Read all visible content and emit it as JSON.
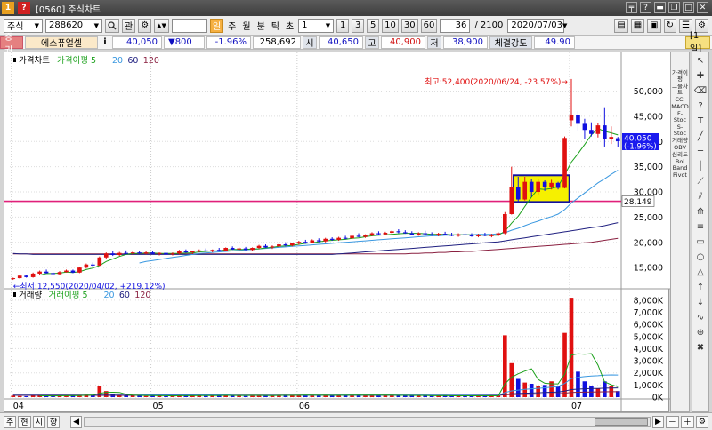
{
  "window": {
    "title": "[0560] 주식차트",
    "app_icon": "1 ?",
    "buttons": [
      "pin-icon",
      "help-icon",
      "minimize-icon",
      "restore-icon",
      "maximize-icon",
      "close-icon"
    ]
  },
  "toolbar": {
    "market": "주식",
    "code": "288620",
    "search_glyph": "🔍",
    "관": "관",
    "period_tabs": [
      "일",
      "주",
      "월",
      "분",
      "틱",
      "초"
    ],
    "interval_value": "1",
    "interval_btns": [
      "1",
      "3",
      "5",
      "10",
      "30",
      "60"
    ],
    "count_value": "36",
    "total_value": "/ 2100",
    "date_value": "2020/07/03"
  },
  "infobar": {
    "badge": "증권",
    "name": "에스퓨얼셀",
    "info_icon": "i",
    "price": "40,050",
    "change": "▼800",
    "rate": "-1.96%",
    "volume": "258,692",
    "open_lbl": "시",
    "open": "40,650",
    "high_lbl": "고",
    "high": "40,900",
    "low_lbl": "저",
    "low": "38,900",
    "strength_lbl": "체결강도",
    "strength": "49.90",
    "period_badge": "[1일]"
  },
  "price_chart": {
    "legend": [
      "가격차트",
      "가격이평 5",
      "20",
      "60",
      "120"
    ],
    "max_label": "최고:52,400(2020/06/24, -23.57%)→",
    "min_label": "←최저:12,550(2020/04/02, +219.12%)",
    "current_price": "40,050",
    "current_rate": "(-1.96%)",
    "line_value": "28,149",
    "y_ticks": [
      "50,000",
      "45,000",
      "40,000",
      "35,000",
      "30,000",
      "25,000",
      "20,000",
      "15,000"
    ]
  },
  "volume_chart": {
    "legend": [
      "거래량",
      "거래이평 5",
      "20",
      "60",
      "120"
    ],
    "y_ticks": [
      "8,000K",
      "7,000K",
      "6,000K",
      "5,000K",
      "4,000K",
      "3,000K",
      "2,000K",
      "1,000K",
      "0K"
    ]
  },
  "x_ticks": [
    "04",
    "05",
    "06",
    "07"
  ],
  "right_panel": [
    "가격이평",
    "그물차트",
    "CCI",
    "MACD",
    "F-Stoc",
    "S-Stoc",
    "거래량",
    "OBV",
    "심리도",
    "Bol Band",
    "Pivot"
  ],
  "bottom": {
    "tabs": [
      "주",
      "현",
      "시",
      "향"
    ]
  },
  "colors": {
    "up": "#e01010",
    "down": "#1010e0",
    "ma5": "#1aa01a",
    "ma20": "#3a98e0",
    "ma60": "#202080",
    "ma120": "#8a2040",
    "hline": "#e0207a",
    "highlight": "#f6f000"
  },
  "chart_data": {
    "type": "candlestick",
    "price_ylim": [
      11500,
      54500
    ],
    "volume_ylim": [
      0,
      8500
    ],
    "candles": [
      [
        12.8,
        13.0,
        12.55,
        12.9
      ],
      [
        12.9,
        13.6,
        12.8,
        13.4
      ],
      [
        13.4,
        13.6,
        13.0,
        13.1
      ],
      [
        13.1,
        14.0,
        13.0,
        13.8
      ],
      [
        13.8,
        14.4,
        13.6,
        14.2
      ],
      [
        14.2,
        14.6,
        13.8,
        13.9
      ],
      [
        13.9,
        14.2,
        13.5,
        13.7
      ],
      [
        13.7,
        14.3,
        13.6,
        14.1
      ],
      [
        14.1,
        14.6,
        14.0,
        14.4
      ],
      [
        14.4,
        14.6,
        13.9,
        14.0
      ],
      [
        14.0,
        15.2,
        13.9,
        15.0
      ],
      [
        15.0,
        15.8,
        14.8,
        15.6
      ],
      [
        15.6,
        16.0,
        15.2,
        15.4
      ],
      [
        15.4,
        17.2,
        15.3,
        17.0
      ],
      [
        17.0,
        18.0,
        16.7,
        17.8
      ],
      [
        17.8,
        18.3,
        17.3,
        17.5
      ],
      [
        17.5,
        18.1,
        17.3,
        17.9
      ],
      [
        17.9,
        18.4,
        17.6,
        17.8
      ],
      [
        17.8,
        18.2,
        17.5,
        18.0
      ],
      [
        18.0,
        18.3,
        17.7,
        17.8
      ],
      [
        17.8,
        18.2,
        17.6,
        18.0
      ],
      [
        18.0,
        18.2,
        17.6,
        17.7
      ],
      [
        17.7,
        18.0,
        17.4,
        17.9
      ],
      [
        17.9,
        18.1,
        17.5,
        17.6
      ],
      [
        17.6,
        18.0,
        17.4,
        17.8
      ],
      [
        17.8,
        18.5,
        17.6,
        18.3
      ],
      [
        18.3,
        18.6,
        17.9,
        18.0
      ],
      [
        18.0,
        18.3,
        17.7,
        18.2
      ],
      [
        18.2,
        18.6,
        18.0,
        18.4
      ],
      [
        18.4,
        18.8,
        18.1,
        18.2
      ],
      [
        18.2,
        18.6,
        18.0,
        18.5
      ],
      [
        18.5,
        18.9,
        18.2,
        18.3
      ],
      [
        18.3,
        19.0,
        18.2,
        18.9
      ],
      [
        18.9,
        19.2,
        18.5,
        18.6
      ],
      [
        18.6,
        19.0,
        18.4,
        18.8
      ],
      [
        18.8,
        19.1,
        18.4,
        18.5
      ],
      [
        18.5,
        19.0,
        18.3,
        18.9
      ],
      [
        18.9,
        19.5,
        18.7,
        19.3
      ],
      [
        19.3,
        19.6,
        18.9,
        19.0
      ],
      [
        19.0,
        19.4,
        18.7,
        19.2
      ],
      [
        19.2,
        19.8,
        19.0,
        19.6
      ],
      [
        19.6,
        20.0,
        19.2,
        19.4
      ],
      [
        19.4,
        19.9,
        19.2,
        19.8
      ],
      [
        19.8,
        20.3,
        19.5,
        20.1
      ],
      [
        20.1,
        20.5,
        19.7,
        19.9
      ],
      [
        19.9,
        20.6,
        19.8,
        20.4
      ],
      [
        20.4,
        20.8,
        20.0,
        20.2
      ],
      [
        20.2,
        20.9,
        20.0,
        20.7
      ],
      [
        20.7,
        21.0,
        20.3,
        20.5
      ],
      [
        20.5,
        21.1,
        20.3,
        20.9
      ],
      [
        20.9,
        21.3,
        20.6,
        20.8
      ],
      [
        20.8,
        21.5,
        20.6,
        21.3
      ],
      [
        21.3,
        21.8,
        21.0,
        21.1
      ],
      [
        21.1,
        21.6,
        20.9,
        21.4
      ],
      [
        21.4,
        22.0,
        21.2,
        21.8
      ],
      [
        21.8,
        22.2,
        21.4,
        21.6
      ],
      [
        21.6,
        22.1,
        21.4,
        21.9
      ],
      [
        21.9,
        22.4,
        21.6,
        22.2
      ],
      [
        22.2,
        22.6,
        21.8,
        22.0
      ],
      [
        22.0,
        22.4,
        21.7,
        21.8
      ],
      [
        21.8,
        22.2,
        21.4,
        21.5
      ],
      [
        21.5,
        22.0,
        21.3,
        21.8
      ],
      [
        21.8,
        22.3,
        21.5,
        21.6
      ],
      [
        21.6,
        22.0,
        21.3,
        21.4
      ],
      [
        21.4,
        21.9,
        21.2,
        21.7
      ],
      [
        21.7,
        22.1,
        21.4,
        21.5
      ],
      [
        21.5,
        21.9,
        21.2,
        21.3
      ],
      [
        21.3,
        21.8,
        21.1,
        21.6
      ],
      [
        21.6,
        22.0,
        21.3,
        21.4
      ],
      [
        21.4,
        21.8,
        21.1,
        21.2
      ],
      [
        21.2,
        21.7,
        21.0,
        21.5
      ],
      [
        21.5,
        21.9,
        21.2,
        21.3
      ],
      [
        21.3,
        21.7,
        21.0,
        21.4
      ],
      [
        21.4,
        22.0,
        21.2,
        21.8
      ],
      [
        21.8,
        26.0,
        21.6,
        25.6
      ],
      [
        25.6,
        35.0,
        25.5,
        31.0
      ],
      [
        31.0,
        33.0,
        28.0,
        28.5
      ],
      [
        28.5,
        33.0,
        28.3,
        32.0
      ],
      [
        32.0,
        32.5,
        29.0,
        30.0
      ],
      [
        30.0,
        32.5,
        29.5,
        32.0
      ],
      [
        32.0,
        32.3,
        30.2,
        31.0
      ],
      [
        31.0,
        32.4,
        30.5,
        31.8
      ],
      [
        31.8,
        32.0,
        30.5,
        30.8
      ],
      [
        30.8,
        41.0,
        30.7,
        40.7
      ],
      [
        44.2,
        52.4,
        43.0,
        45.2
      ],
      [
        45.2,
        46.0,
        42.0,
        43.5
      ],
      [
        43.5,
        44.5,
        40.5,
        42.3
      ],
      [
        42.3,
        43.8,
        41.0,
        41.5
      ],
      [
        41.5,
        43.6,
        40.8,
        43.2
      ],
      [
        43.2,
        46.8,
        39.0,
        40.5
      ],
      [
        40.5,
        43.0,
        39.5,
        40.9
      ],
      [
        40.65,
        40.9,
        38.9,
        40.05
      ]
    ],
    "volumes": [
      120,
      90,
      80,
      110,
      150,
      100,
      90,
      120,
      160,
      110,
      180,
      200,
      140,
      950,
      500,
      220,
      150,
      120,
      140,
      110,
      100,
      130,
      110,
      90,
      100,
      140,
      120,
      110,
      150,
      100,
      120,
      140,
      210,
      130,
      110,
      100,
      180,
      160,
      120,
      110,
      150,
      190,
      140,
      170,
      130,
      160,
      140,
      180,
      150,
      160,
      130,
      170,
      200,
      150,
      140,
      160,
      150,
      180,
      130,
      120,
      110,
      140,
      130,
      100,
      120,
      110,
      90,
      130,
      110,
      90,
      110,
      100,
      90,
      140,
      5100,
      2800,
      1500,
      1200,
      1100,
      900,
      1000,
      1300,
      950,
      5300,
      8200,
      2100,
      1300,
      900,
      700,
      1300,
      900,
      500
    ],
    "ma5": [
      null,
      null,
      null,
      null,
      13.5,
      13.8,
      13.8,
      13.9,
      14.1,
      14.0,
      14.2,
      14.6,
      14.9,
      15.4,
      16.2,
      16.7,
      17.2,
      17.6,
      17.8,
      17.8,
      17.9,
      17.9,
      17.8,
      17.8,
      17.8,
      17.8,
      17.9,
      17.9,
      18.1,
      18.2,
      18.3,
      18.3,
      18.5,
      18.6,
      18.6,
      18.6,
      18.7,
      18.7,
      18.9,
      19.0,
      19.2,
      19.3,
      19.4,
      19.6,
      19.8,
      19.9,
      20.1,
      20.3,
      20.4,
      20.5,
      20.6,
      20.8,
      20.9,
      21.1,
      21.3,
      21.4,
      21.5,
      21.6,
      21.7,
      21.8,
      21.8,
      21.8,
      21.7,
      21.6,
      21.6,
      21.6,
      21.5,
      21.5,
      21.5,
      21.5,
      21.4,
      21.4,
      21.4,
      21.4,
      22.2,
      23.8,
      25.2,
      27.1,
      29.0,
      30.6,
      30.5,
      30.7,
      31.1,
      33.4,
      35.9,
      37.6,
      39.4,
      41.3,
      42.6,
      42.0,
      41.7,
      41.3
    ],
    "ma20": [
      null,
      null,
      null,
      null,
      null,
      null,
      null,
      null,
      null,
      null,
      null,
      null,
      null,
      null,
      null,
      null,
      null,
      null,
      null,
      15.9,
      16.2,
      16.4,
      16.6,
      16.8,
      17.0,
      17.2,
      17.4,
      17.6,
      17.8,
      17.9,
      18.0,
      18.1,
      18.2,
      18.3,
      18.4,
      18.5,
      18.6,
      18.7,
      18.8,
      18.9,
      19.0,
      19.1,
      19.2,
      19.3,
      19.4,
      19.5,
      19.6,
      19.7,
      19.8,
      19.9,
      20.0,
      20.1,
      20.2,
      20.3,
      20.4,
      20.5,
      20.6,
      20.7,
      20.8,
      20.9,
      21.0,
      21.1,
      21.2,
      21.3,
      21.3,
      21.4,
      21.4,
      21.5,
      21.5,
      21.5,
      21.6,
      21.6,
      21.6,
      21.7,
      21.9,
      22.4,
      22.8,
      23.3,
      23.8,
      24.2,
      24.7,
      25.1,
      25.6,
      26.5,
      27.8,
      28.8,
      29.8,
      30.8,
      31.8,
      32.6,
      33.5,
      34.3
    ],
    "ma60": [
      17.8,
      17.7,
      17.7,
      17.6,
      17.6,
      17.6,
      17.6,
      17.6,
      17.6,
      17.6,
      17.6,
      17.6,
      17.6,
      17.6,
      17.6,
      17.6,
      17.6,
      17.6,
      17.6,
      17.6,
      17.6,
      17.6,
      17.6,
      17.6,
      17.6,
      17.6,
      17.6,
      17.6,
      17.6,
      17.6,
      17.6,
      17.6,
      17.6,
      17.6,
      17.6,
      17.6,
      17.6,
      17.6,
      17.6,
      17.6,
      17.6,
      17.6,
      17.6,
      17.6,
      17.6,
      17.6,
      17.6,
      17.6,
      17.6,
      17.7,
      17.8,
      17.9,
      18.0,
      18.1,
      18.2,
      18.3,
      18.4,
      18.5,
      18.6,
      18.7,
      18.8,
      18.9,
      19.0,
      19.1,
      19.2,
      19.3,
      19.4,
      19.5,
      19.6,
      19.7,
      19.8,
      19.9,
      20.0,
      20.1,
      20.3,
      20.5,
      20.7,
      20.9,
      21.1,
      21.3,
      21.5,
      21.7,
      21.9,
      22.1,
      22.3,
      22.5,
      22.7,
      22.9,
      23.1,
      23.3,
      23.6,
      23.9
    ],
    "ma120": [
      17.7,
      17.7,
      17.7,
      17.7,
      17.7,
      17.7,
      17.7,
      17.7,
      17.7,
      17.7,
      17.7,
      17.7,
      17.7,
      17.7,
      17.7,
      17.7,
      17.7,
      17.7,
      17.7,
      17.7,
      17.7,
      17.7,
      17.7,
      17.7,
      17.7,
      17.7,
      17.7,
      17.7,
      17.7,
      17.7,
      17.7,
      17.7,
      17.7,
      17.7,
      17.7,
      17.7,
      17.7,
      17.7,
      17.7,
      17.7,
      17.7,
      17.7,
      17.7,
      17.7,
      17.7,
      17.7,
      17.7,
      17.7,
      17.7,
      17.7,
      17.7,
      17.7,
      17.7,
      17.7,
      17.7,
      17.7,
      17.7,
      17.7,
      17.7,
      17.7,
      17.8,
      17.8,
      17.9,
      17.9,
      18.0,
      18.0,
      18.1,
      18.1,
      18.2,
      18.2,
      18.3,
      18.4,
      18.5,
      18.6,
      18.7,
      18.8,
      18.9,
      19.0,
      19.1,
      19.2,
      19.3,
      19.4,
      19.5,
      19.6,
      19.7,
      19.8,
      19.9,
      20.0,
      20.2,
      20.4,
      20.6,
      20.8
    ],
    "vol_ma5": [
      null,
      null,
      null,
      null,
      110,
      108,
      106,
      108,
      118,
      116,
      132,
      152,
      158,
      316,
      394,
      402,
      392,
      226,
      166,
      148,
      124,
      122,
      120,
      114,
      106,
      114,
      118,
      114,
      124,
      124,
      128,
      124,
      146,
      142,
      142,
      138,
      148,
      146,
      140,
      134,
      144,
      146,
      146,
      152,
      158,
      158,
      152,
      160,
      148,
      156,
      152,
      158,
      166,
      162,
      158,
      164,
      160,
      166,
      150,
      146,
      138,
      140,
      138,
      120,
      120,
      122,
      110,
      110,
      110,
      108,
      108,
      108,
      108,
      112,
      1092,
      1636,
      1926,
      2148,
      2340,
      1460,
      1140,
      1100,
      1090,
      1890,
      3470,
      3570,
      3540,
      3590,
      2640,
      1260,
      1020,
      860
    ],
    "vol_ma20": [
      null,
      null,
      null,
      null,
      null,
      null,
      null,
      null,
      null,
      null,
      null,
      null,
      null,
      null,
      null,
      null,
      null,
      null,
      null,
      198,
      197,
      199,
      200,
      199,
      196,
      198,
      199,
      199,
      198,
      198,
      198,
      195,
      199,
      156,
      136,
      136,
      138,
      140,
      139,
      139,
      141,
      144,
      145,
      149,
      151,
      152,
      153,
      156,
      156,
      159,
      160,
      162,
      163,
      163,
      164,
      165,
      164,
      165,
      165,
      165,
      163,
      161,
      160,
      157,
      155,
      153,
      149,
      147,
      145,
      143,
      140,
      138,
      135,
      134,
      381,
      514,
      580,
      639,
      688,
      727,
      771,
      830,
      872,
      1128,
      1533,
      1636,
      1695,
      1734,
      1763,
      1817,
      1829,
      1828
    ],
    "vol_ma60": [
      160,
      160,
      160,
      160,
      160,
      160,
      160,
      160,
      160,
      160,
      160,
      160,
      160,
      160,
      160,
      160,
      160,
      160,
      160,
      160,
      160,
      160,
      160,
      160,
      160,
      160,
      160,
      160,
      160,
      160,
      160,
      160,
      160,
      160,
      160,
      160,
      160,
      160,
      160,
      160,
      160,
      160,
      160,
      160,
      160,
      160,
      160,
      160,
      160,
      160,
      160,
      160,
      160,
      160,
      160,
      160,
      160,
      160,
      160,
      160,
      160,
      160,
      160,
      160,
      160,
      160,
      160,
      160,
      160,
      160,
      160,
      160,
      160,
      160,
      240,
      280,
      300,
      320,
      340,
      360,
      380,
      400,
      420,
      500,
      620,
      660,
      690,
      710,
      720,
      740,
      750,
      760
    ],
    "vol_ma120": [
      150,
      150,
      150,
      150,
      150,
      150,
      150,
      150,
      150,
      150,
      150,
      150,
      150,
      150,
      150,
      150,
      150,
      150,
      150,
      150,
      150,
      150,
      150,
      150,
      150,
      150,
      150,
      150,
      150,
      150,
      150,
      150,
      150,
      150,
      150,
      150,
      150,
      150,
      150,
      150,
      150,
      150,
      150,
      150,
      150,
      150,
      150,
      150,
      150,
      150,
      150,
      150,
      150,
      150,
      150,
      150,
      150,
      150,
      150,
      150,
      150,
      150,
      150,
      150,
      150,
      150,
      150,
      150,
      150,
      150,
      150,
      150,
      150,
      150,
      190,
      210,
      220,
      230,
      240,
      250,
      260,
      270,
      280,
      320,
      380,
      400,
      410,
      420,
      430,
      440,
      445,
      450
    ]
  }
}
